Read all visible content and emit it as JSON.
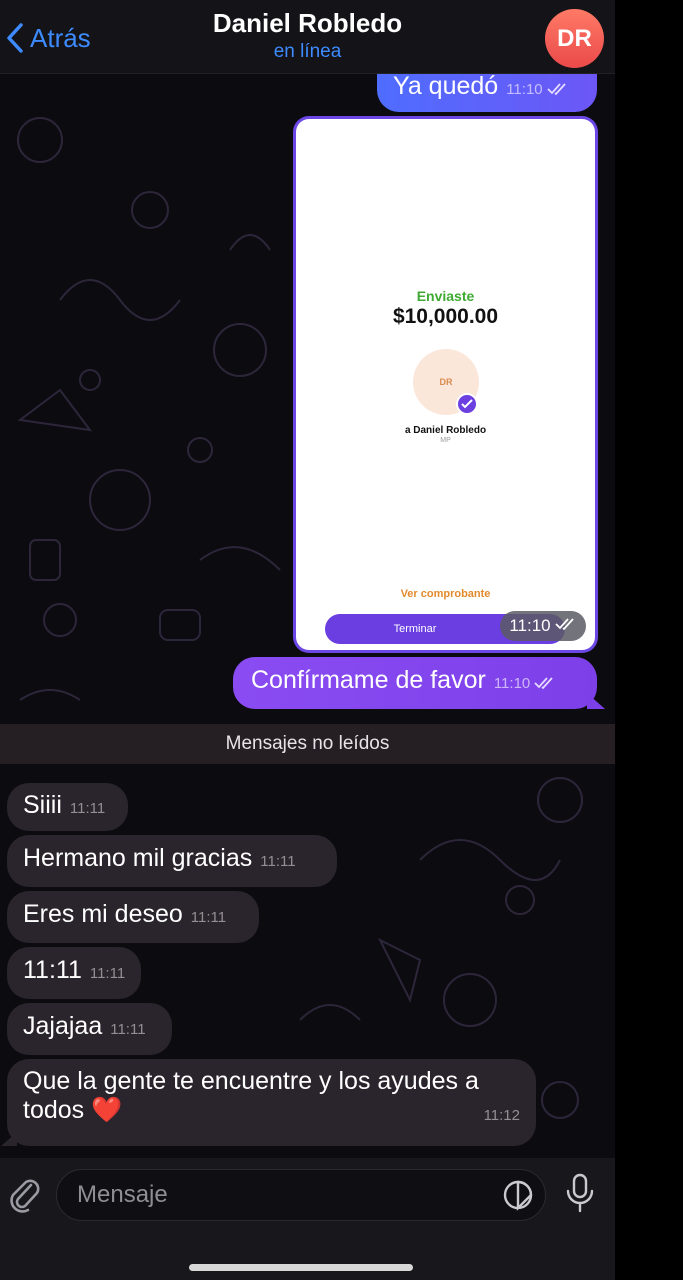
{
  "header": {
    "back_label": "Atrás",
    "contact_name": "Daniel Robledo",
    "status": "en línea",
    "avatar_initials": "DR"
  },
  "messages_out": {
    "m1": {
      "text": "Ya quedó",
      "time": "11:10"
    },
    "receipt_image": {
      "sent_label": "Enviaste",
      "amount": "$10,000.00",
      "avatar_initials": "DR",
      "recipient": "a Daniel Robledo",
      "recipient_sub": "MP",
      "receipt_link": "Ver comprobante",
      "finish_button": "Terminar",
      "time": "11:10"
    },
    "m2": {
      "text": "Confírmame de favor",
      "time": "11:10"
    }
  },
  "unread_divider": "Mensajes no leídos",
  "messages_in": [
    {
      "text": "Siiii",
      "time": "11:11"
    },
    {
      "text": "Hermano mil gracias",
      "time": "11:11"
    },
    {
      "text": "Eres mi deseo",
      "time": "11:11"
    },
    {
      "text": "11:11",
      "time": "11:11"
    },
    {
      "text": "Jajajaa",
      "time": "11:11"
    },
    {
      "text_line1": "Que la gente te encuentre y los ayudes a",
      "text_line2": "todos ❤️",
      "time": "11:12"
    }
  ],
  "input": {
    "placeholder": "Mensaje"
  },
  "colors": {
    "accent_blue": "#3d8bff",
    "outgoing_purple": "#7d3fe8",
    "avatar_red": "#ea4a4a"
  },
  "icons": [
    "chevron-left-icon",
    "double-check-icon",
    "verified-check-icon",
    "paperclip-icon",
    "sticker-icon",
    "microphone-icon"
  ]
}
